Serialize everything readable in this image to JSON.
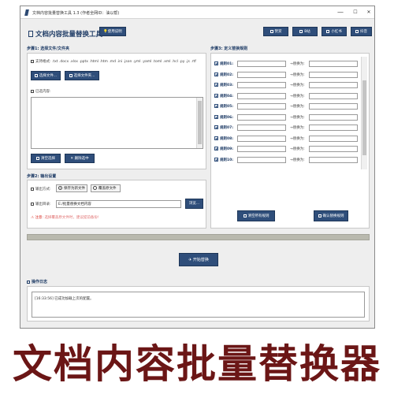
{
  "window": {
    "title": "文档内容批量替换工具 1.3 (作者全网ID：油以帮)",
    "controls": {
      "minimize": "—",
      "maximize": "☐",
      "close": "✕"
    }
  },
  "header": {
    "title": "文档内容批量替换工具",
    "usage_button": "使用说明",
    "toolbar": [
      "赞赏",
      "B站",
      "小红书",
      "抖音"
    ]
  },
  "step1": {
    "label": "步骤1: 选择文件/文件夹",
    "formats": "支持格式: .txt .docx .xlsx .pptx .html .htm .md .ini .json .yml .yaml .toml .xml .hcl .py .js .rtf",
    "select_file": "选择文件...",
    "select_folder": "选择文件夹...",
    "selected_label": "已选内容:",
    "clear_button": "清空选择",
    "remove_button": "删除选中"
  },
  "step2": {
    "label": "步骤2: 输出设置",
    "mode_label": "输出方式:",
    "mode_options": [
      "保存为新文件",
      "覆盖原文件"
    ],
    "mode_selected": "保存为新文件",
    "dir_label": "输出目录:",
    "dir_value": "E:/批量替换文档内容",
    "browse_button": "浏览...",
    "note_prefix": "注意:",
    "note_text": "选择覆盖原文件时，建议提前备份!"
  },
  "step3": {
    "label": "步骤3: 定义替换规则",
    "rules": [
      "规则01:",
      "规则02:",
      "规则03:",
      "规则04:",
      "规则05:",
      "规则06:",
      "规则07:",
      "规则08:",
      "规则09:",
      "规则10:"
    ],
    "replace_with": "→替换为:",
    "clear_rules": "清空所有规则",
    "confirm_rules": "确认替换规则"
  },
  "progress": {
    "value": 0
  },
  "actions": {
    "start": "开始替换"
  },
  "log": {
    "label": "操作日志",
    "lines": [
      "[16:33:56] 已成功加载上次的配置。"
    ]
  },
  "caption": "文档内容批量替换器",
  "colors": {
    "accent": "#2f4e7a",
    "caption": "#6b1616",
    "warning": "#d9322a"
  }
}
